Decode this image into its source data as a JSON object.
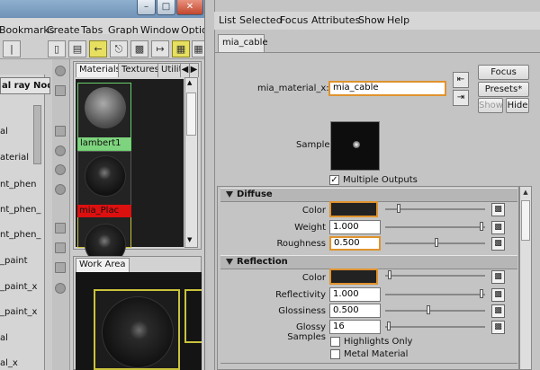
{
  "left_window": {
    "menus": [
      "Bookmarks",
      "Create",
      "Tabs",
      "Graph",
      "Window",
      "Optio"
    ],
    "window_buttons": {
      "minimize": "–",
      "maximize": "□",
      "close": "✕"
    },
    "node_list": {
      "header": "al ray Nodes",
      "items": [
        "al",
        "aterial",
        "nt_phen",
        "nt_phen_",
        "nt_phen_",
        "_paint",
        "_paint_x",
        "_paint_x",
        "al",
        "al_x"
      ]
    },
    "materials_tabs": [
      "Materials",
      "Textures",
      "Utilit"
    ],
    "swatches": [
      {
        "label": "lambert1",
        "label_color": "#7ed47e"
      },
      {
        "label": "",
        "label_color": ""
      },
      {
        "label": "mia_Plac",
        "label_color": "#dd1010"
      }
    ],
    "work_area_tab": "Work Area"
  },
  "right_window": {
    "menus": [
      "List",
      "Selected",
      "Focus",
      "Attributes",
      "Show",
      "Help"
    ],
    "node_tab": "mia_cable",
    "node_name_label": "mia_material_x:",
    "node_name_value": "mia_cable",
    "buttons": {
      "focus": "Focus",
      "presets": "Presets*",
      "show": "Show",
      "hide": "Hide"
    },
    "sample_label": "Sample",
    "multiple_outputs_label": "Multiple Outputs",
    "multiple_outputs_checked": true,
    "diffuse": {
      "title": "Diffuse",
      "rows": [
        {
          "label": "Color",
          "value": ""
        },
        {
          "label": "Weight",
          "value": "1.000"
        },
        {
          "label": "Roughness",
          "value": "0.500"
        }
      ]
    },
    "reflection": {
      "title": "Reflection",
      "rows": [
        {
          "label": "Color",
          "value": ""
        },
        {
          "label": "Reflectivity",
          "value": "1.000"
        },
        {
          "label": "Glossiness",
          "value": "0.500"
        },
        {
          "label": "Glossy Samples",
          "value": "16"
        }
      ],
      "checkboxes": [
        {
          "label": "Highlights Only",
          "checked": false
        },
        {
          "label": "Metal Material",
          "checked": false
        }
      ]
    },
    "colors": {
      "accent_highlight": "#e0932e",
      "swatch_dark": "#222222"
    }
  }
}
